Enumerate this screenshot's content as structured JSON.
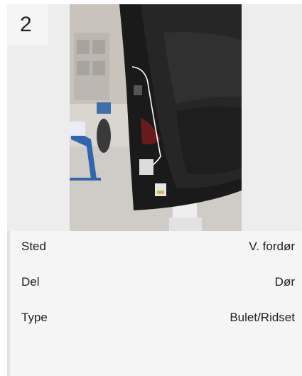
{
  "card": {
    "number": "2",
    "image_icon": "car-door-photo"
  },
  "details": [
    {
      "label": "Sted",
      "value": "V. fordør"
    },
    {
      "label": "Del",
      "value": "Dør"
    },
    {
      "label": "Type",
      "value": "Bulet/Ridset"
    }
  ]
}
